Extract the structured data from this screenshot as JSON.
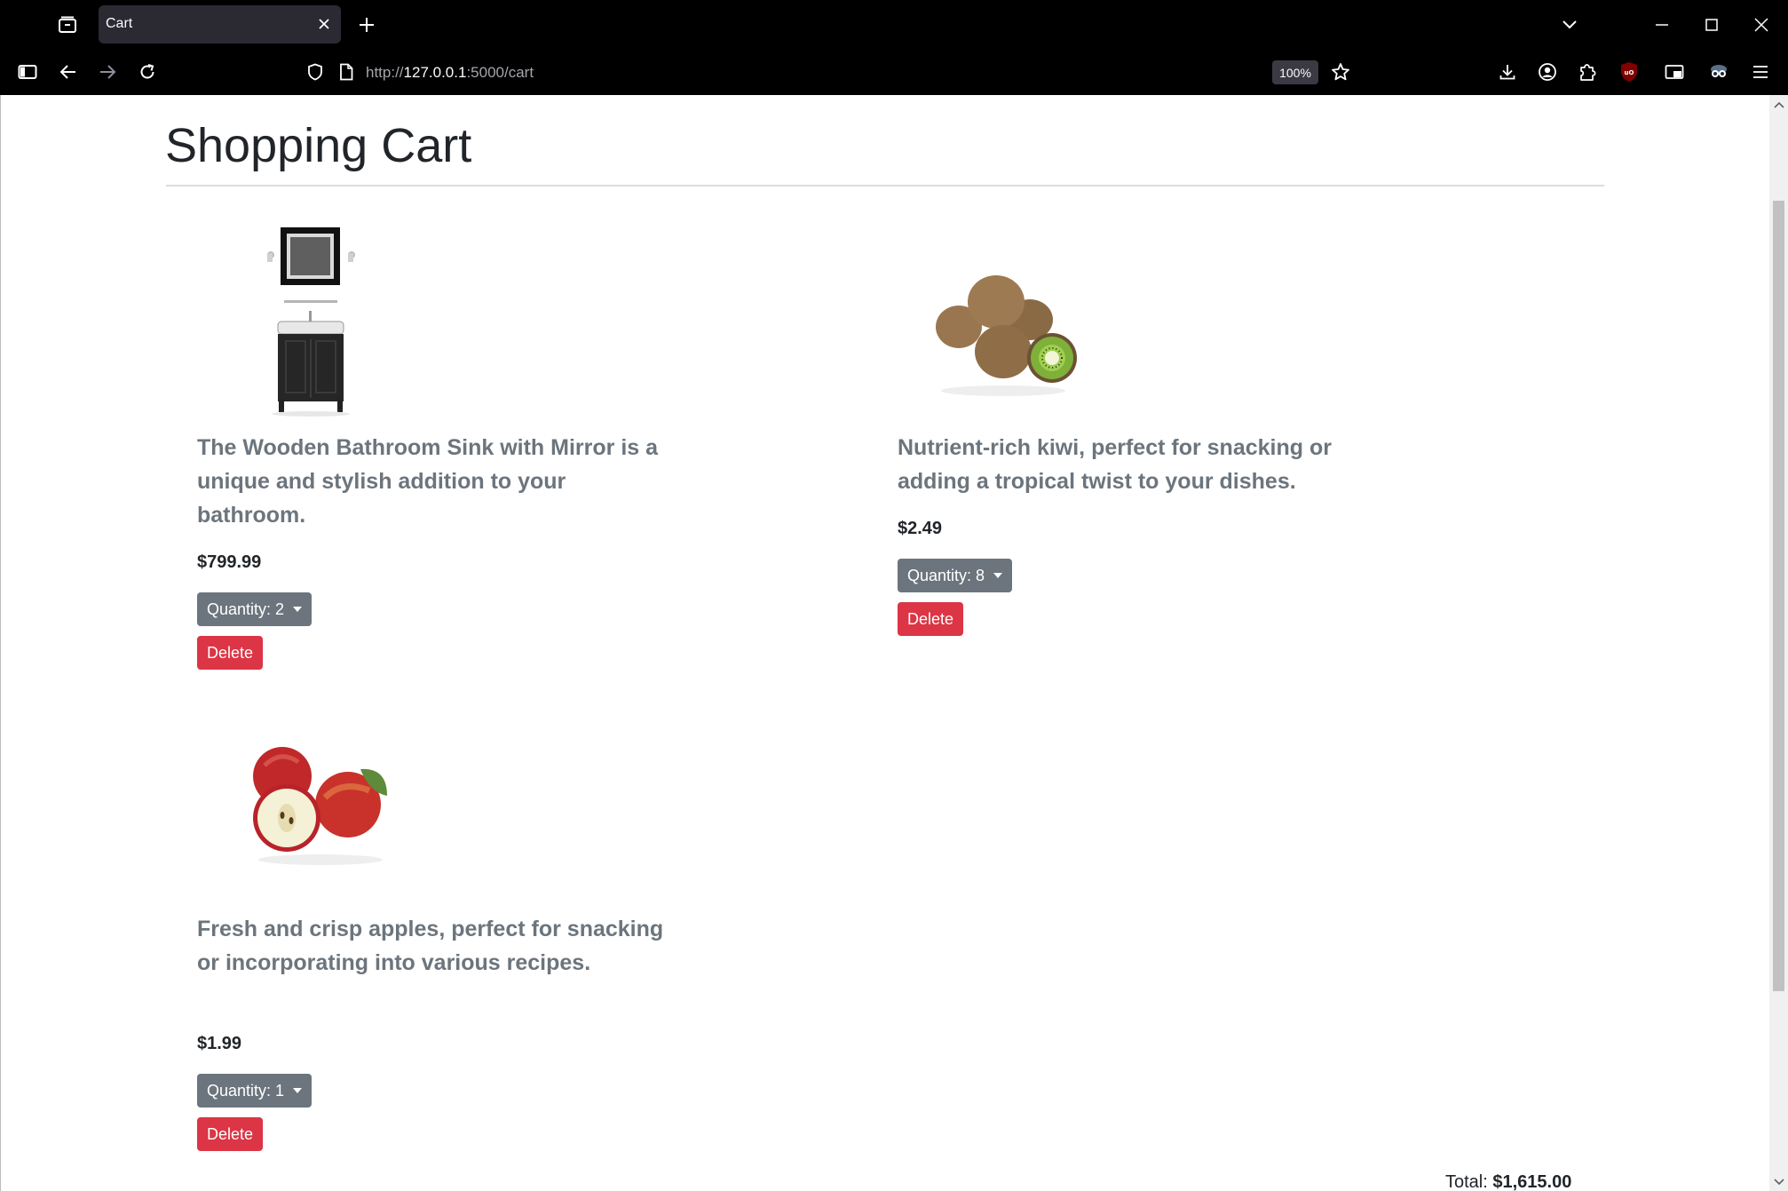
{
  "browser": {
    "tab_title": "Cart",
    "url_prefix": "http://",
    "url_host": "127.0.0.1",
    "url_rest": ":5000/cart",
    "zoom": "100%"
  },
  "page": {
    "title": "Shopping Cart"
  },
  "cart_items": [
    {
      "description": "The Wooden Bathroom Sink with Mirror is a unique and stylish addition to your bathroom.",
      "price": "$799.99",
      "quantity_label": "Quantity: 2",
      "delete_label": "Delete"
    },
    {
      "description": "Nutrient-rich kiwi, perfect for snacking or adding a tropical twist to your dishes.",
      "price": "$2.49",
      "quantity_label": "Quantity: 8",
      "delete_label": "Delete"
    },
    {
      "description": "Fresh and crisp apples, perfect for snacking or incorporating into various recipes.",
      "price": "$1.99",
      "quantity_label": "Quantity: 1",
      "delete_label": "Delete"
    }
  ],
  "summary": {
    "total_label": "Total:",
    "total_value": "$1,615.00"
  },
  "colors": {
    "quantity_button": "#6c757d",
    "delete_button": "#dc3545",
    "description_text": "#6c757d"
  }
}
